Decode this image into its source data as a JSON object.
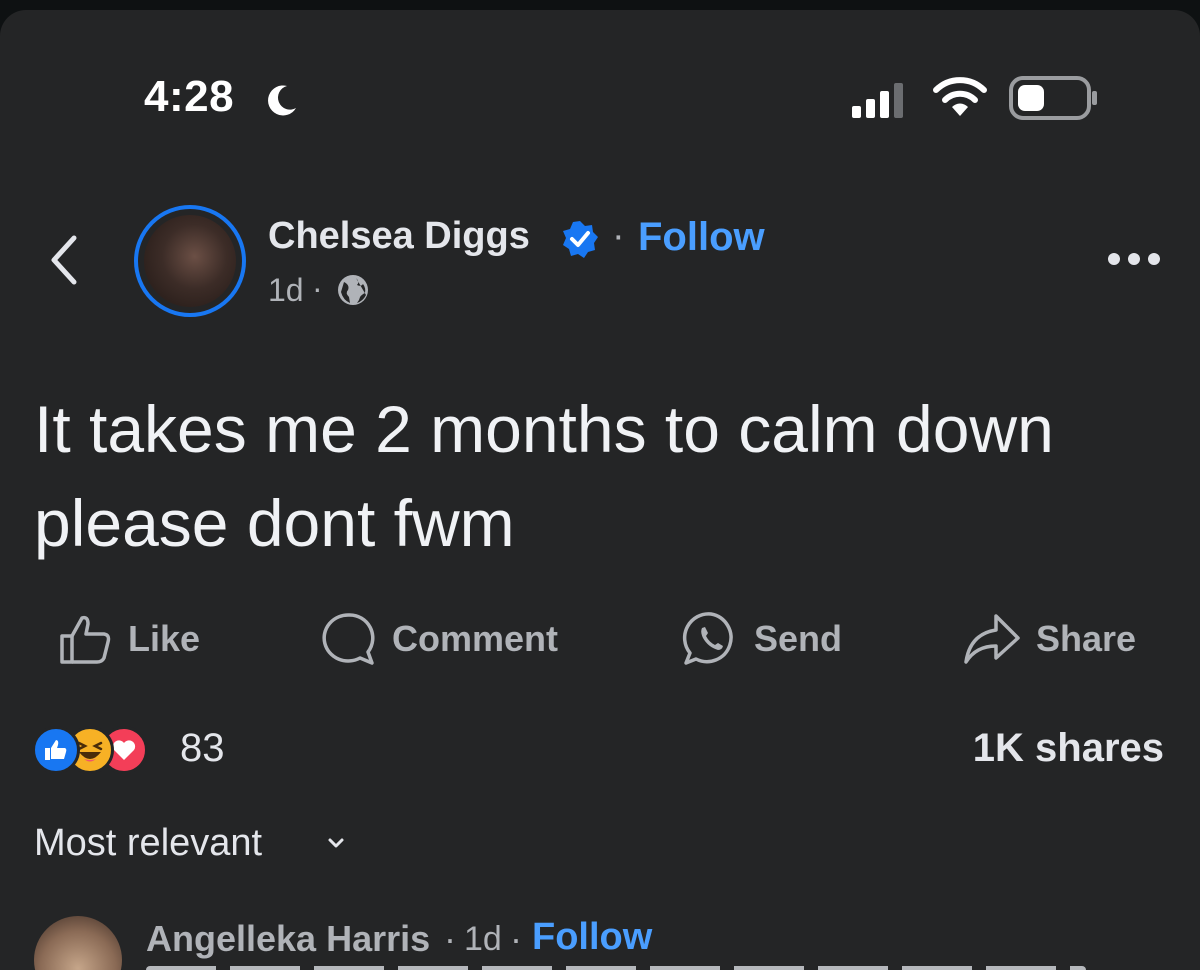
{
  "status_bar": {
    "time": "4:28",
    "moon_icon": "moon-icon",
    "signal_icon": "cellular-signal-icon",
    "wifi_icon": "wifi-icon",
    "battery_icon": "battery-icon"
  },
  "post": {
    "author": "Chelsea Diggs",
    "verified": true,
    "separator": "·",
    "follow_label": "Follow",
    "time": "1d",
    "audience_icon": "globe-icon",
    "text": "It takes me 2 months to calm down please dont fwm"
  },
  "actions": {
    "like": "Like",
    "comment": "Comment",
    "send": "Send",
    "share": "Share"
  },
  "engagement": {
    "reaction_count": "83",
    "shares": "1K shares",
    "reactions": [
      "like",
      "haha",
      "love"
    ]
  },
  "comments": {
    "sort_label": "Most relevant",
    "items": [
      {
        "author": "Angelleka Harris",
        "time": "1d",
        "follow_label": "Follow"
      }
    ]
  },
  "colors": {
    "background": "#242526",
    "accent": "#1877f2",
    "link": "#4a9eff",
    "text": "#e4e6eb",
    "muted": "#b0b3b8"
  }
}
